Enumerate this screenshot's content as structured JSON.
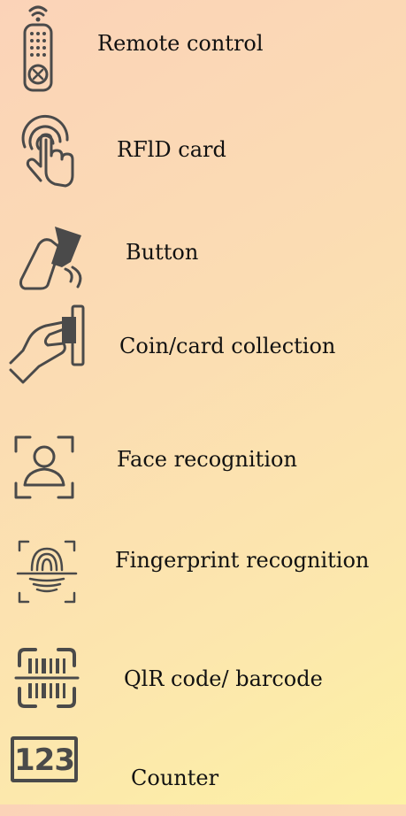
{
  "items": [
    {
      "label": "Remote control",
      "icon": "remote-control-icon"
    },
    {
      "label": "RFlD card",
      "icon": "touch-fingerprint-icon"
    },
    {
      "label": "Button",
      "icon": "card-tap-icon"
    },
    {
      "label": "Coin/card collection",
      "icon": "hand-insert-card-icon"
    },
    {
      "label": "Face recognition",
      "icon": "face-scan-icon"
    },
    {
      "label": "Fingerprint recognition",
      "icon": "fingerprint-scan-icon"
    },
    {
      "label": "QlR code/ barcode",
      "icon": "barcode-scan-icon"
    },
    {
      "label": "Counter",
      "icon": "counter-123-icon"
    }
  ],
  "counter_digits": "123",
  "colors": {
    "icon": "#4a4a4a",
    "text": "#111111"
  }
}
